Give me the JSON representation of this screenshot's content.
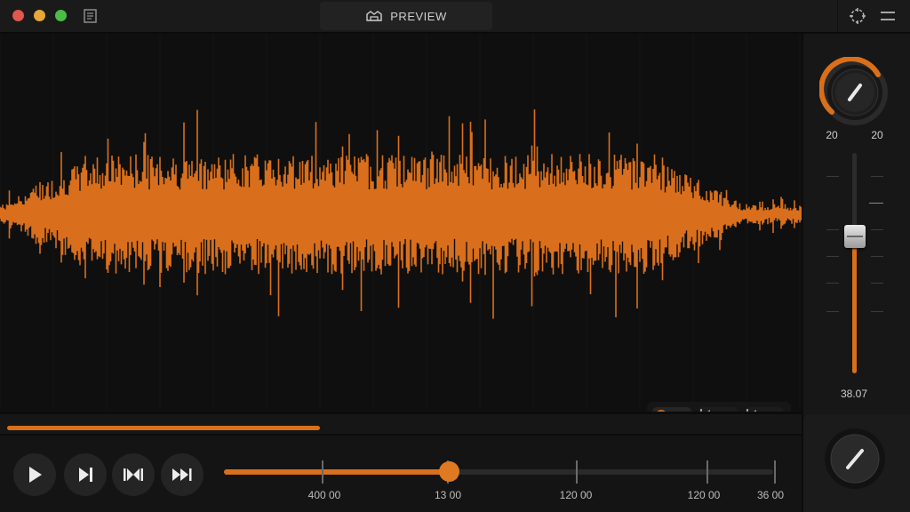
{
  "window": {
    "title": "PREVIEW"
  },
  "icons": {
    "app_icon": "document-icon",
    "title_icon": "preview-icon",
    "right_icons": [
      "crosshair-icon",
      "menu-icon"
    ]
  },
  "colors": {
    "accent": "#d96f1c",
    "waveform": "#d96f1c",
    "background": "#0c0c0c",
    "traffic_red": "#e0574b",
    "traffic_yellow": "#e6a73b",
    "traffic_green": "#4cbc48"
  },
  "overview": {
    "progress": 0.39
  },
  "transport": {
    "buttons": [
      "play-icon",
      "next-track-icon",
      "loop-icon",
      "fast-forward-icon"
    ]
  },
  "scrubber": {
    "position": 0.41,
    "tick_labels": [
      "400 00",
      "13 00",
      "120 00",
      "120 00",
      "36 00"
    ]
  },
  "mini_toolbar": [
    "zoom-icon",
    "skip-back-icon",
    "skip-back-alt-icon"
  ],
  "side": {
    "knob_left_label": "20",
    "knob_right_label": "20",
    "fader_value": "38.07",
    "fader_level": 0.62
  }
}
